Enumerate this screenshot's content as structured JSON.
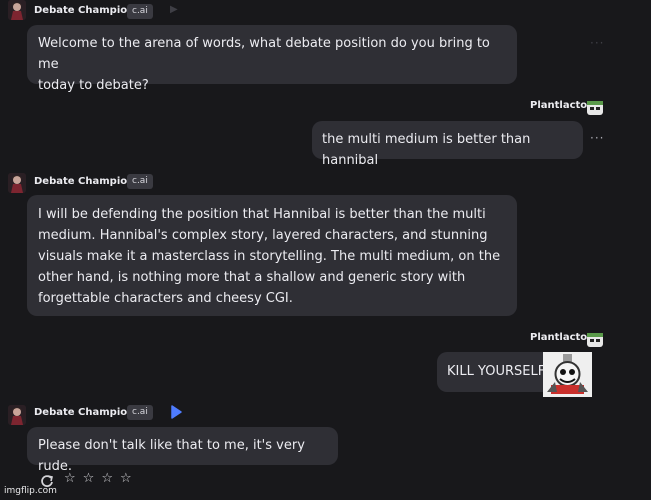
{
  "messages": [
    {
      "sender": "Debate Champion",
      "tag": "c.ai",
      "text": "Welcome to the arena of words, what debate position do you bring to me\ntoday to debate?",
      "menu": "···"
    },
    {
      "sender": "Plantlacto",
      "text": "the multi medium is better than hannibal",
      "menu": "···"
    },
    {
      "sender": "Debate Champion",
      "tag": "c.ai",
      "text": "I will be defending the position that Hannibal is better than the multi\nmedium. Hannibal's complex story, layered characters, and stunning\nvisuals make it a masterclass in storytelling. The multi medium, on the\nother hand, is nothing more that a shallow and generic story with\nforgettable characters and cheesy CGI."
    },
    {
      "sender": "Plantlacto",
      "text": "KILL YOURSELF"
    },
    {
      "sender": "Debate Champion",
      "tag": "c.ai",
      "text": "Please don't talk like that to me, it's very rude."
    }
  ],
  "actions": {
    "regenerate_icon": "refresh-icon",
    "rating_icon": "star-outline-icon",
    "rating_count": 4
  },
  "colors": {
    "background": "#18181b",
    "bubble": "#2f2f35",
    "tag": "#3a3a41",
    "play": "#4f7cff"
  },
  "watermark": "imgflip.com"
}
